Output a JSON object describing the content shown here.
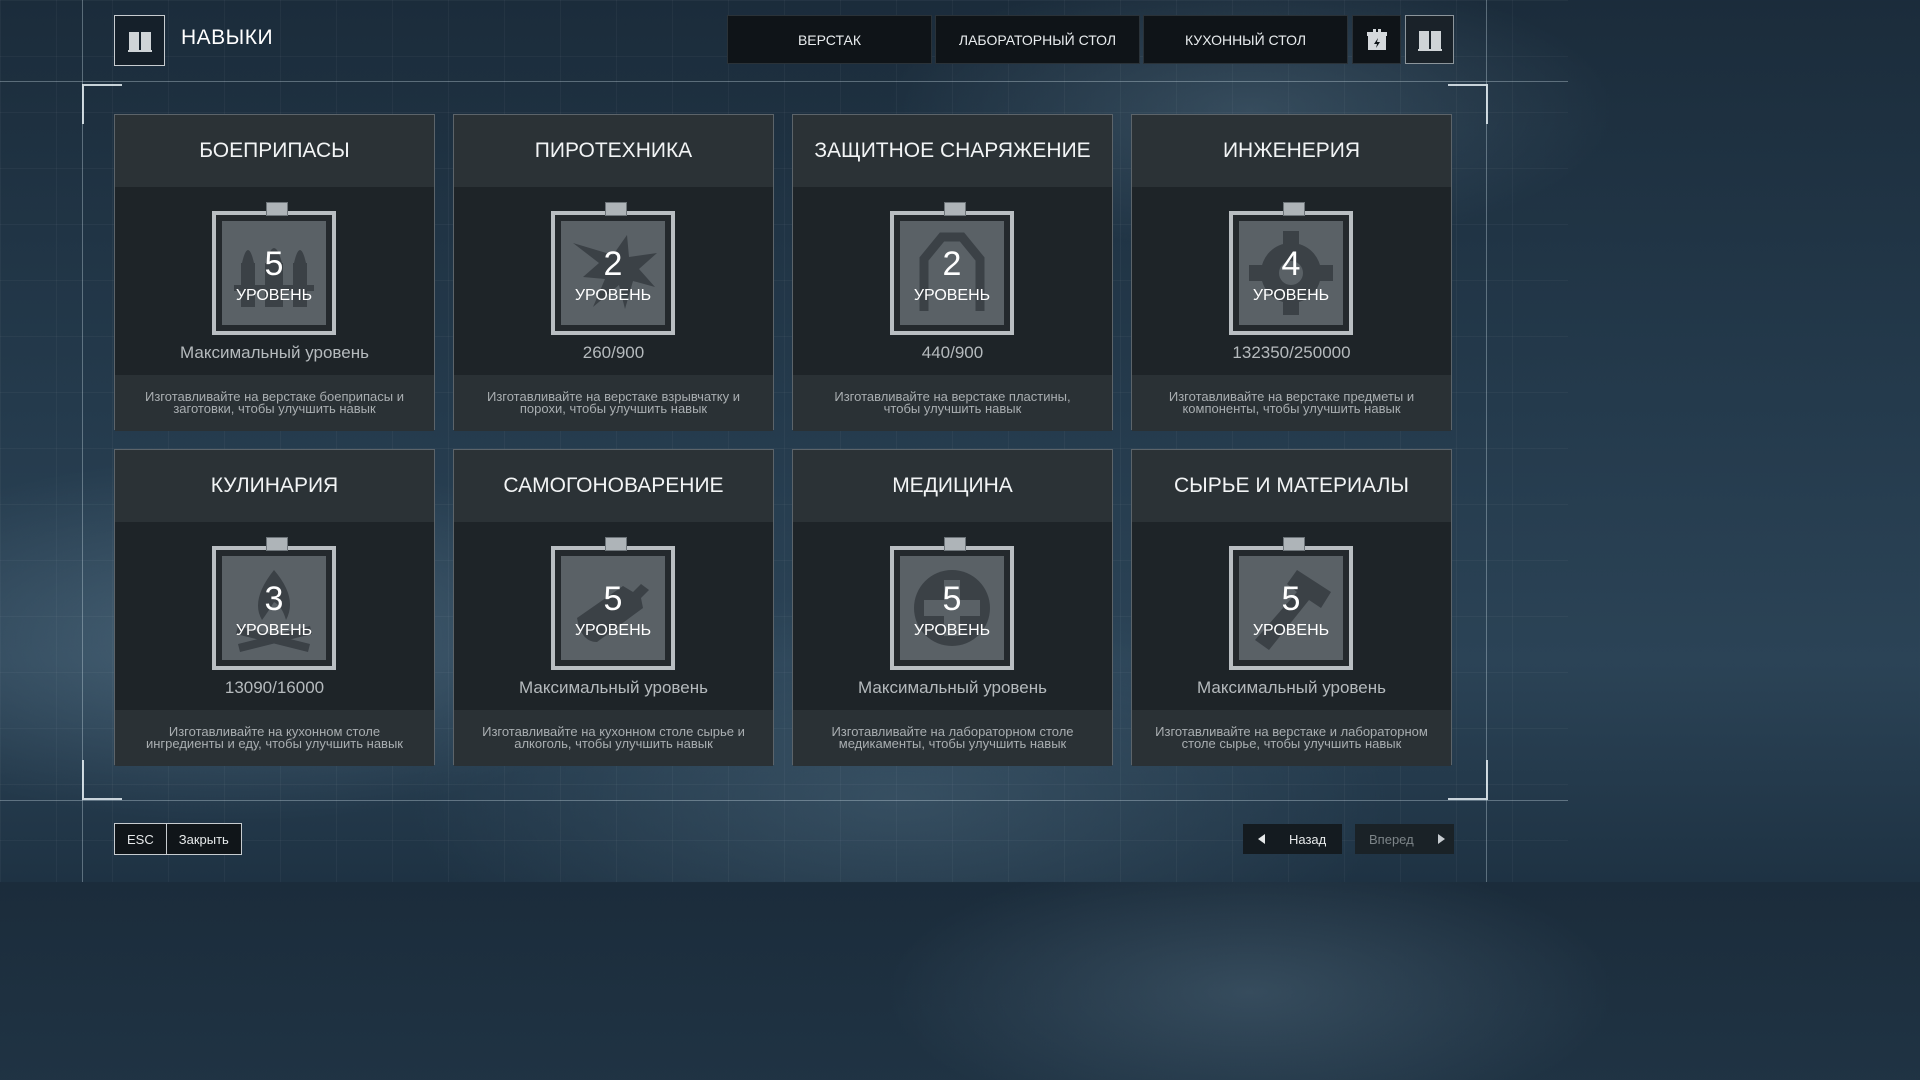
{
  "header": {
    "title": "НАВЫКИ",
    "tabs": [
      "ВЕРСТАК",
      "ЛАБОРАТОРНЫЙ СТОЛ",
      "КУХОННЫЙ СТОЛ"
    ],
    "icons": [
      "book-icon",
      "supply-crate-icon",
      "book-icon"
    ]
  },
  "skills": [
    {
      "name": "БОЕПРИПАСЫ",
      "level": "5",
      "level_label": "УРОВЕНЬ",
      "progress": "Максимальный уровень",
      "description": "Изготавливайте на верстаке боеприпасы и заготовки, чтобы улучшить навык",
      "icon": "ammo-icon"
    },
    {
      "name": "ПИРОТЕХНИКА",
      "level": "2",
      "level_label": "УРОВЕНЬ",
      "progress": "260/900",
      "description": "Изготавливайте на верстаке взрывчатку и порохи, чтобы улучшить навык",
      "icon": "explosion-icon"
    },
    {
      "name": "ЗАЩИТНОЕ СНАРЯЖЕНИЕ",
      "level": "2",
      "level_label": "УРОВЕНЬ",
      "progress": "440/900",
      "description": "Изготавливайте на верстаке пластины, чтобы улучшить навык",
      "icon": "armor-plate-icon"
    },
    {
      "name": "ИНЖЕНЕРИЯ",
      "level": "4",
      "level_label": "УРОВЕНЬ",
      "progress": "132350/250000",
      "description": "Изготавливайте на верстаке предметы и компоненты, чтобы улучшить навык",
      "icon": "gear-icon"
    },
    {
      "name": "КУЛИНАРИЯ",
      "level": "3",
      "level_label": "УРОВЕНЬ",
      "progress": "13090/16000",
      "description": "Изготавливайте на кухонном столе ингредиенты и еду, чтобы улучшить навык",
      "icon": "campfire-icon"
    },
    {
      "name": "САМОГОНОВАРЕНИЕ",
      "level": "5",
      "level_label": "УРОВЕНЬ",
      "progress": "Максимальный уровень",
      "description": "Изготавливайте на кухонном столе сырье и алкоголь, чтобы улучшить навык",
      "icon": "bottle-icon"
    },
    {
      "name": "МЕДИЦИНА",
      "level": "5",
      "level_label": "УРОВЕНЬ",
      "progress": "Максимальный уровень",
      "description": "Изготавливайте на лабораторном столе медикаменты, чтобы улучшить навык",
      "icon": "medical-cross-icon"
    },
    {
      "name": "СЫРЬЕ И МАТЕРИАЛЫ",
      "level": "5",
      "level_label": "УРОВЕНЬ",
      "progress": "Максимальный уровень",
      "description": "Изготавливайте на верстаке и лабораторном столе сырье, чтобы улучшить навык",
      "icon": "hammer-icon"
    }
  ],
  "footer": {
    "esc_key": "ESC",
    "close_label": "Закрыть",
    "back_label": "Назад",
    "forward_label": "Вперед"
  }
}
